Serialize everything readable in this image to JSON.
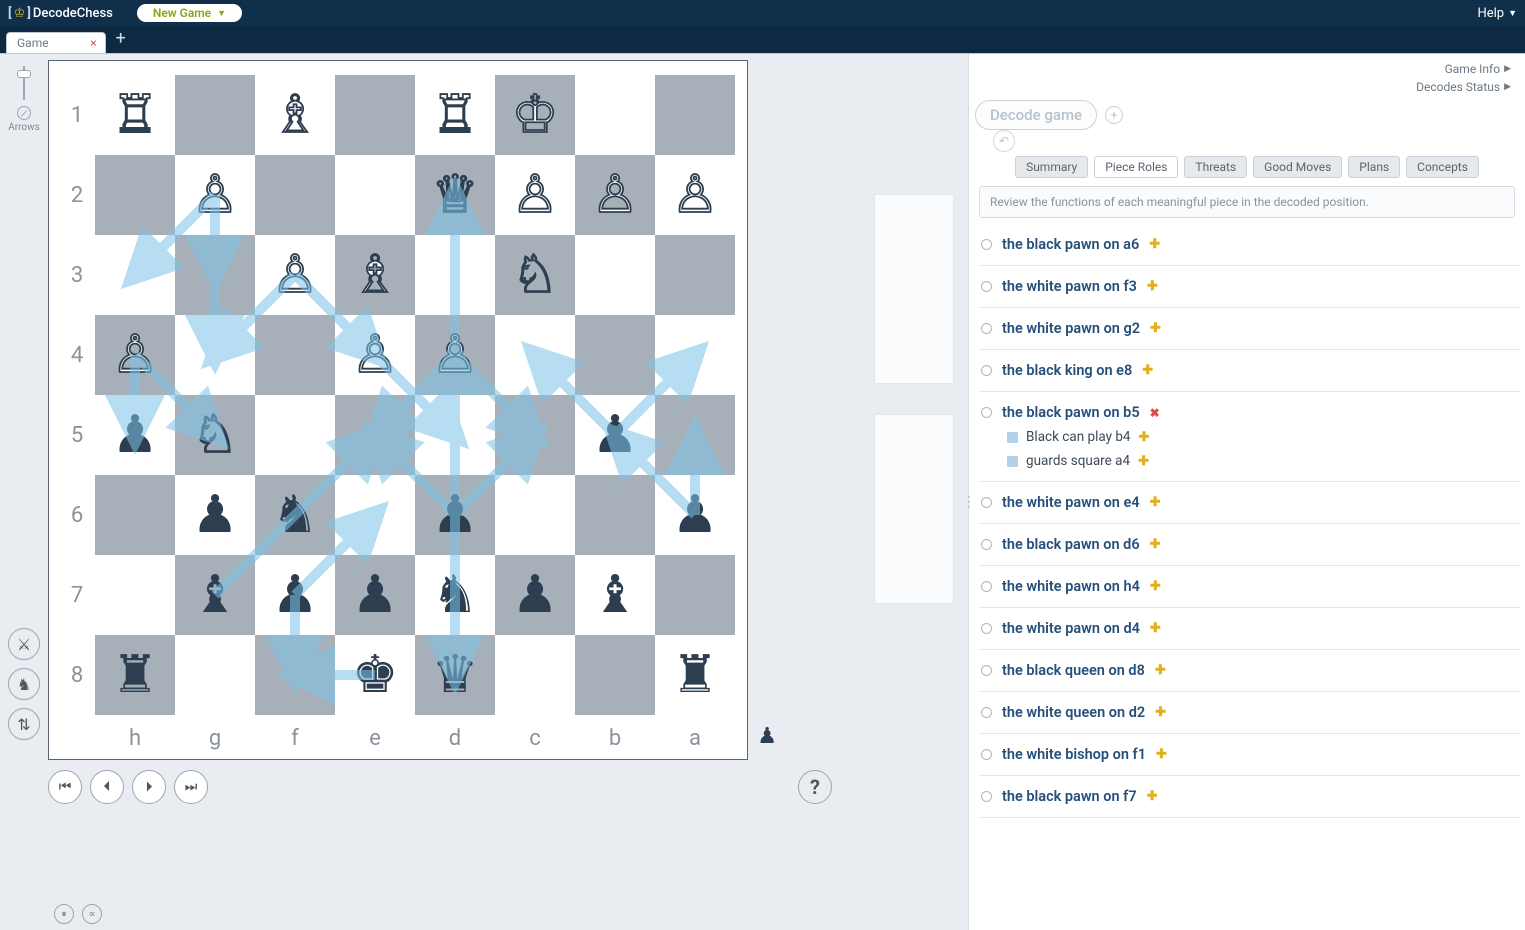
{
  "header": {
    "brand": "DecodeChess",
    "new_game": "New Game",
    "help": "Help"
  },
  "tabbar": {
    "tab_label": "Game"
  },
  "left_rail": {
    "arrows_label": "Arrows"
  },
  "board": {
    "files": [
      "h",
      "g",
      "f",
      "e",
      "d",
      "c",
      "b",
      "a"
    ],
    "ranks": [
      "1",
      "2",
      "3",
      "4",
      "5",
      "6",
      "7",
      "8"
    ],
    "turn_indicator": "♟",
    "pieces": [
      {
        "sq": "h1",
        "g": "♖",
        "c": "w"
      },
      {
        "sq": "f1",
        "g": "♗",
        "c": "w"
      },
      {
        "sq": "d1",
        "g": "♖",
        "c": "w"
      },
      {
        "sq": "c1",
        "g": "♔",
        "c": "w"
      },
      {
        "sq": "g2",
        "g": "♙",
        "c": "w"
      },
      {
        "sq": "d2",
        "g": "♕",
        "c": "w"
      },
      {
        "sq": "c2",
        "g": "♙",
        "c": "w"
      },
      {
        "sq": "b2",
        "g": "♙",
        "c": "w"
      },
      {
        "sq": "a2",
        "g": "♙",
        "c": "w"
      },
      {
        "sq": "f3",
        "g": "♙",
        "c": "w"
      },
      {
        "sq": "e3",
        "g": "♗",
        "c": "w"
      },
      {
        "sq": "c3",
        "g": "♘",
        "c": "w"
      },
      {
        "sq": "h4",
        "g": "♙",
        "c": "w"
      },
      {
        "sq": "e4",
        "g": "♙",
        "c": "w"
      },
      {
        "sq": "d4",
        "g": "♙",
        "c": "w"
      },
      {
        "sq": "h5",
        "g": "♟",
        "c": "b"
      },
      {
        "sq": "g5",
        "g": "♘",
        "c": "w"
      },
      {
        "sq": "b5",
        "g": "♟",
        "c": "b"
      },
      {
        "sq": "g6",
        "g": "♟",
        "c": "b"
      },
      {
        "sq": "f6",
        "g": "♞",
        "c": "b"
      },
      {
        "sq": "d6",
        "g": "♟",
        "c": "b"
      },
      {
        "sq": "a6",
        "g": "♟",
        "c": "b"
      },
      {
        "sq": "g7",
        "g": "♝",
        "c": "b"
      },
      {
        "sq": "f7",
        "g": "♟",
        "c": "b"
      },
      {
        "sq": "e7",
        "g": "♟",
        "c": "b"
      },
      {
        "sq": "d7",
        "g": "♞",
        "c": "b"
      },
      {
        "sq": "c7",
        "g": "♟",
        "c": "b"
      },
      {
        "sq": "b7",
        "g": "♝",
        "c": "b"
      },
      {
        "sq": "h8",
        "g": "♜",
        "c": "b"
      },
      {
        "sq": "e8",
        "g": "♚",
        "c": "b"
      },
      {
        "sq": "d8",
        "g": "♛",
        "c": "b"
      },
      {
        "sq": "a8",
        "g": "♜",
        "c": "b"
      }
    ],
    "arrows": [
      {
        "from": "g2",
        "to": "h3"
      },
      {
        "from": "g2",
        "to": "g3"
      },
      {
        "from": "g2",
        "to": "g4"
      },
      {
        "from": "f3",
        "to": "g4"
      },
      {
        "from": "f3",
        "to": "e4"
      },
      {
        "from": "h4",
        "to": "g5"
      },
      {
        "from": "h4",
        "to": "h5"
      },
      {
        "from": "e4",
        "to": "d5"
      },
      {
        "from": "d4",
        "to": "e5"
      },
      {
        "from": "d4",
        "to": "c5"
      },
      {
        "from": "b5",
        "to": "a4"
      },
      {
        "from": "b5",
        "to": "c4"
      },
      {
        "from": "a6",
        "to": "b5"
      },
      {
        "from": "a6",
        "to": "a5"
      },
      {
        "from": "d6",
        "to": "e5"
      },
      {
        "from": "d6",
        "to": "c5"
      },
      {
        "from": "f7",
        "to": "e6"
      },
      {
        "from": "f7",
        "to": "f8"
      },
      {
        "from": "d8",
        "to": "d2"
      },
      {
        "from": "d2",
        "to": "d8"
      },
      {
        "from": "d8",
        "to": "d4"
      },
      {
        "from": "g7",
        "to": "e5"
      },
      {
        "from": "e8",
        "to": "f8"
      }
    ]
  },
  "nav": {
    "help_btn": "?"
  },
  "right": {
    "game_info": "Game Info",
    "decodes_status": "Decodes Status",
    "decode_game": "Decode game",
    "tabs": [
      {
        "label": "Summary",
        "active": false
      },
      {
        "label": "Piece Roles",
        "active": true
      },
      {
        "label": "Threats",
        "active": false
      },
      {
        "label": "Good Moves",
        "active": false
      },
      {
        "label": "Plans",
        "active": false
      },
      {
        "label": "Concepts",
        "active": false
      }
    ],
    "hint": "Review the functions of each meaningful piece in the decoded position.",
    "roles": [
      {
        "label": "the black pawn on a6",
        "mark": "+"
      },
      {
        "label": "the white pawn on f3",
        "mark": "+"
      },
      {
        "label": "the white pawn on g2",
        "mark": "+"
      },
      {
        "label": "the black king on e8",
        "mark": "+"
      },
      {
        "label": "the black pawn on b5",
        "mark": "x",
        "subs": [
          {
            "text": "Black can play  b4",
            "mark": "+"
          },
          {
            "text": "guards square a4",
            "mark": "+"
          }
        ]
      },
      {
        "label": "the white pawn on e4",
        "mark": "+"
      },
      {
        "label": "the black pawn on d6",
        "mark": "+"
      },
      {
        "label": "the white pawn on h4",
        "mark": "+"
      },
      {
        "label": "the white pawn on d4",
        "mark": "+"
      },
      {
        "label": "the black queen on d8",
        "mark": "+"
      },
      {
        "label": "the white queen on d2",
        "mark": "+"
      },
      {
        "label": "the white bishop on f1",
        "mark": "+"
      },
      {
        "label": "the black pawn on f7",
        "mark": "+"
      }
    ]
  }
}
